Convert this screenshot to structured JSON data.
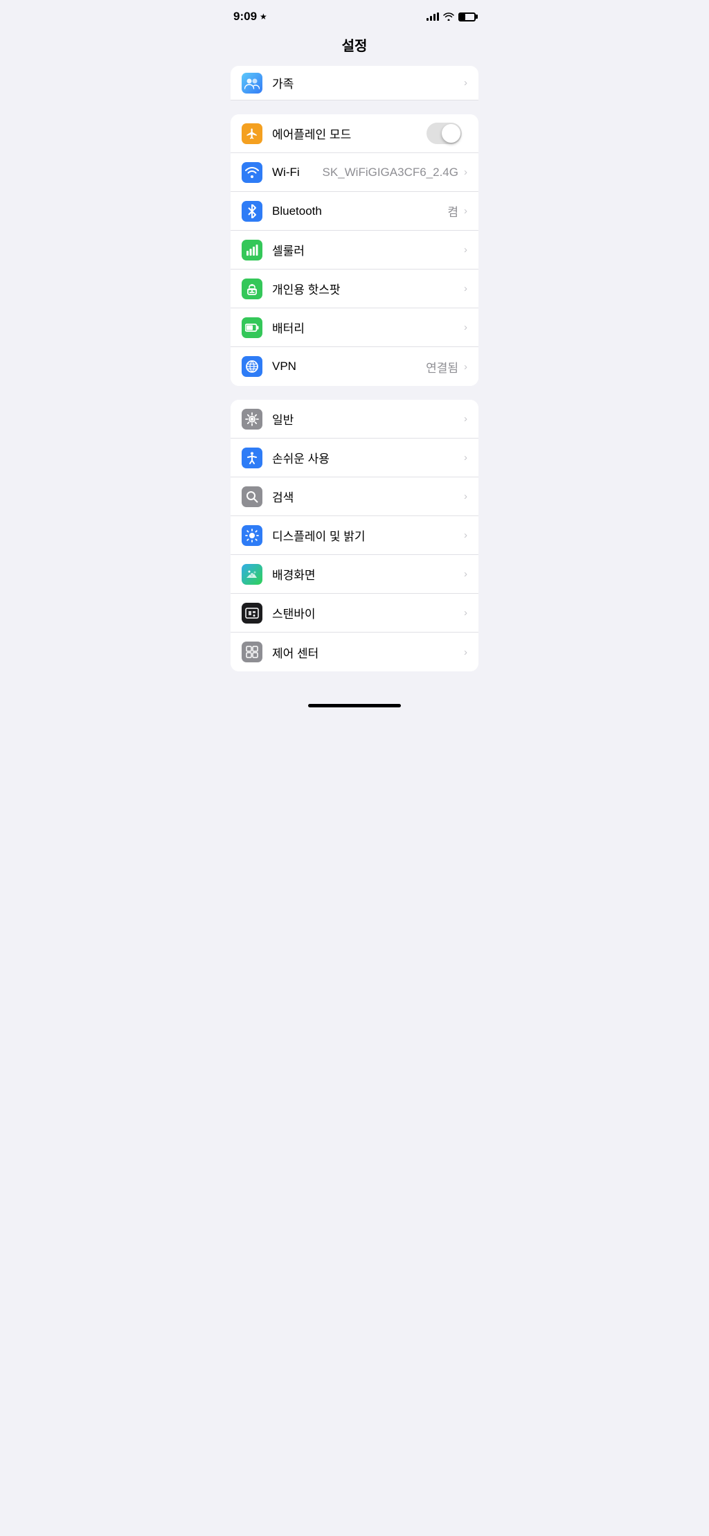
{
  "statusBar": {
    "time": "9:09",
    "star": "★"
  },
  "pageTitle": "설정",
  "sections": {
    "profile": {
      "family": {
        "label": "가족",
        "icon": "👨‍👩‍👧‍👦"
      }
    },
    "network": [
      {
        "id": "airplane",
        "label": "에어플레인 모드",
        "iconColor": "icon-orange",
        "iconSymbol": "✈",
        "type": "toggle",
        "value": "",
        "toggled": false
      },
      {
        "id": "wifi",
        "label": "Wi-Fi",
        "iconColor": "icon-blue",
        "iconSymbol": "wifi",
        "type": "value-chevron",
        "value": "SK_WiFiGIGA3CF6_2.4G"
      },
      {
        "id": "bluetooth",
        "label": "Bluetooth",
        "iconColor": "icon-bluetooth",
        "iconSymbol": "bluetooth",
        "type": "value-chevron",
        "value": "켬"
      },
      {
        "id": "cellular",
        "label": "셀룰러",
        "iconColor": "icon-green",
        "iconSymbol": "cellular",
        "type": "chevron",
        "value": ""
      },
      {
        "id": "hotspot",
        "label": "개인용 핫스팟",
        "iconColor": "icon-green",
        "iconSymbol": "hotspot",
        "type": "chevron",
        "value": ""
      },
      {
        "id": "battery",
        "label": "배터리",
        "iconColor": "icon-green",
        "iconSymbol": "battery",
        "type": "chevron",
        "value": ""
      },
      {
        "id": "vpn",
        "label": "VPN",
        "iconColor": "icon-blue",
        "iconSymbol": "🌐",
        "type": "value-chevron",
        "value": "연결됨"
      }
    ],
    "general": [
      {
        "id": "general",
        "label": "일반",
        "iconColor": "icon-gray",
        "iconSymbol": "gear",
        "type": "chevron"
      },
      {
        "id": "accessibility",
        "label": "손쉬운 사용",
        "iconColor": "icon-blue",
        "iconSymbol": "accessibility",
        "type": "chevron"
      },
      {
        "id": "search",
        "label": "검색",
        "iconColor": "icon-gray",
        "iconSymbol": "search",
        "type": "chevron"
      },
      {
        "id": "display",
        "label": "디스플레이 및 밝기",
        "iconColor": "icon-blue",
        "iconSymbol": "brightness",
        "type": "chevron"
      },
      {
        "id": "wallpaper",
        "label": "배경화면",
        "iconColor": "icon-teal",
        "iconSymbol": "wallpaper",
        "type": "chevron"
      },
      {
        "id": "standby",
        "label": "스탠바이",
        "iconColor": "icon-black",
        "iconSymbol": "standby",
        "type": "chevron"
      },
      {
        "id": "control-center",
        "label": "제어 센터",
        "iconColor": "icon-gray",
        "iconSymbol": "control",
        "type": "chevron"
      }
    ]
  }
}
